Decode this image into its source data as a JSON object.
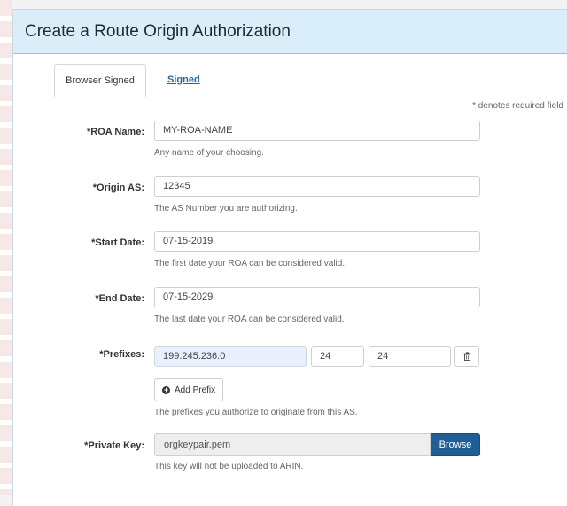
{
  "card": {
    "title": "Create a Route Origin Authorization"
  },
  "tabs": [
    {
      "label": "Browser Signed",
      "active": true
    },
    {
      "label": "Signed",
      "active": false
    }
  ],
  "required_note": "* denotes required field",
  "form": {
    "roa_name": {
      "label": "*ROA Name:",
      "value": "MY-ROA-NAME",
      "help": "Any name of your choosing."
    },
    "origin_as": {
      "label": "*Origin AS:",
      "value": "12345",
      "help": "The AS Number you are authorizing."
    },
    "start_date": {
      "label": "*Start Date:",
      "value": "07-15-2019",
      "help": "The first date your ROA can be considered valid."
    },
    "end_date": {
      "label": "*End Date:",
      "value": "07-15-2029",
      "help": "The last date your ROA can be considered valid."
    },
    "prefixes": {
      "label": "*Prefixes:",
      "ip": "199.245.236.0",
      "length": "24",
      "max_length": "24",
      "add_label": "Add Prefix",
      "help": "The prefixes you authorize to originate from this AS."
    },
    "private_key": {
      "label": "*Private Key:",
      "file": "orgkeypair.pem",
      "browse_label": "Browse",
      "help": "This key will not be uploaded to ARIN."
    }
  },
  "icons": {
    "delete": "trash-icon",
    "add": "plus-circle-icon"
  },
  "colors": {
    "header_bg": "#d9eef8",
    "browse_bg": "#1f5f95",
    "link": "#1f6aa5"
  }
}
